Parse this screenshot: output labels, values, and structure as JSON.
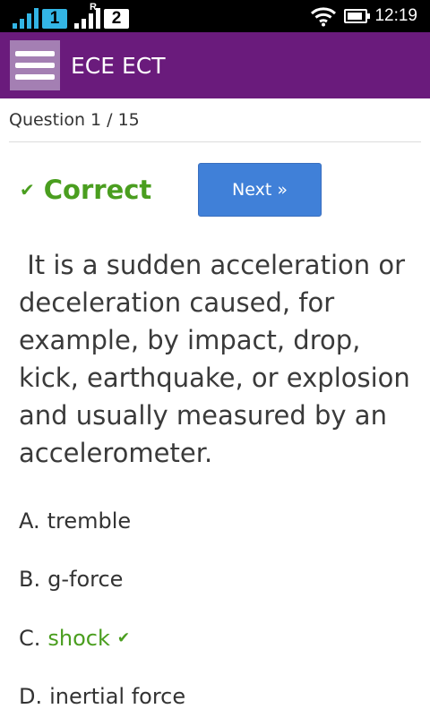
{
  "status_bar": {
    "sim1_label": "1",
    "roaming_indicator": "R",
    "sim2_label": "2",
    "wifi_icon": "wifi-icon",
    "battery_level": 0.9,
    "time": "12:19"
  },
  "app_bar": {
    "menu_icon": "menu-icon",
    "title": "ECE ECT",
    "color": "#6a1b7c"
  },
  "quiz": {
    "question_counter": "Question 1 / 15",
    "result_label": "Correct",
    "result_icon": "checkmark-icon",
    "next_label": "Next »",
    "question_text": " It is a sudden acceleration or deceleration caused, for example, by impact, drop, kick, earthquake, or explosion and usually measured by an accelerometer.",
    "options": [
      {
        "letter": "A.",
        "text": "tremble",
        "correct": false
      },
      {
        "letter": "B.",
        "text": "g-force",
        "correct": false
      },
      {
        "letter": "C.",
        "text": "shock",
        "correct": true
      },
      {
        "letter": "D.",
        "text": "inertial force",
        "correct": false
      }
    ],
    "correct_color": "#4a9e1f"
  }
}
